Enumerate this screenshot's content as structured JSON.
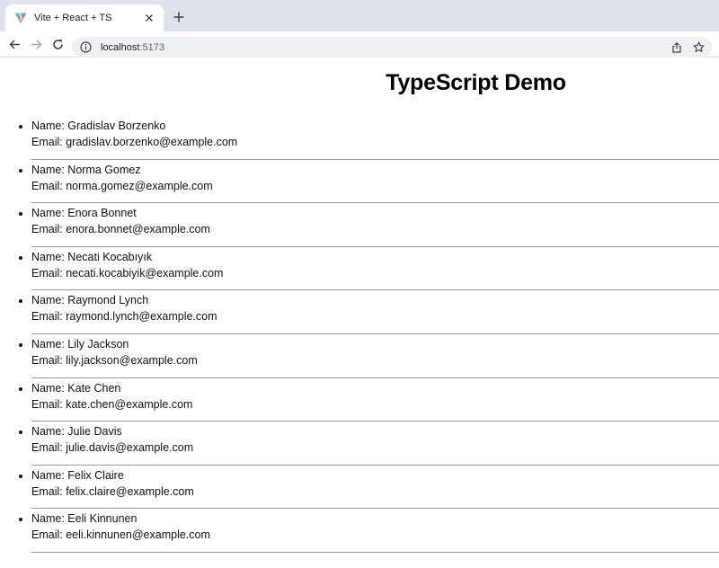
{
  "browser": {
    "tab_title": "Vite + React + TS",
    "url_host": "localhost",
    "url_port": ":5173"
  },
  "page": {
    "title": "TypeScript Demo"
  },
  "users": [
    {
      "name": "Name: Gradislav Borzenko",
      "email": "Email: gradislav.borzenko@example.com"
    },
    {
      "name": "Name: Norma Gomez",
      "email": "Email: norma.gomez@example.com"
    },
    {
      "name": "Name: Enora Bonnet",
      "email": "Email: enora.bonnet@example.com"
    },
    {
      "name": "Name: Necati Kocabıyık",
      "email": "Email: necati.kocabiyik@example.com"
    },
    {
      "name": "Name: Raymond Lynch",
      "email": "Email: raymond.lynch@example.com"
    },
    {
      "name": "Name: Lily Jackson",
      "email": "Email: lily.jackson@example.com"
    },
    {
      "name": "Name: Kate Chen",
      "email": "Email: kate.chen@example.com"
    },
    {
      "name": "Name: Julie Davis",
      "email": "Email: julie.davis@example.com"
    },
    {
      "name": "Name: Felix Claire",
      "email": "Email: felix.claire@example.com"
    },
    {
      "name": "Name: Eeli Kinnunen",
      "email": "Email: eeli.kinnunen@example.com"
    }
  ],
  "icons": {
    "favicon": "vite-logo-icon",
    "close": "close-icon",
    "new_tab": "plus-icon",
    "back": "back-arrow-icon",
    "forward": "forward-arrow-icon",
    "reload": "reload-icon",
    "site_info": "info-icon",
    "share": "share-icon",
    "bookmark": "star-icon"
  }
}
